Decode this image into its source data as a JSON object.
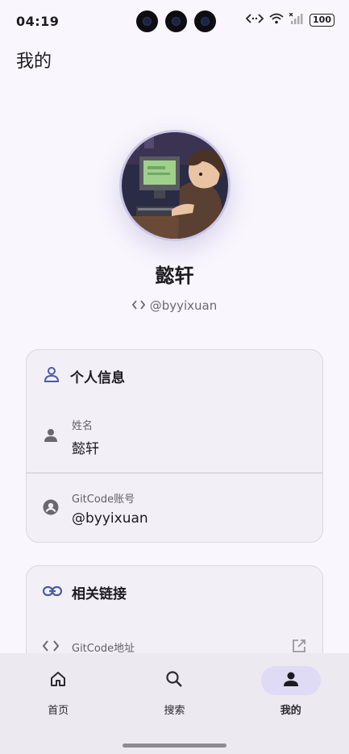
{
  "status_bar": {
    "time": "04:19",
    "battery": "100"
  },
  "page": {
    "title": "我的"
  },
  "profile": {
    "name": "懿轩",
    "handle": "@byyixuan"
  },
  "personal_info": {
    "title": "个人信息",
    "rows": [
      {
        "label": "姓名",
        "value": "懿轩"
      },
      {
        "label": "GitCode账号",
        "value": "@byyixuan"
      }
    ]
  },
  "links": {
    "title": "相关链接",
    "rows": [
      {
        "label": "GitCode地址"
      }
    ]
  },
  "bottom_nav": {
    "items": [
      {
        "label": "首页",
        "icon": "home-icon"
      },
      {
        "label": "搜索",
        "icon": "search-icon"
      },
      {
        "label": "我的",
        "icon": "person-icon",
        "active": true
      }
    ]
  },
  "colors": {
    "background": "#f9f6fd",
    "card": "#f2eff6",
    "accent": "#4a5ba8",
    "active_pill": "#dfdbf5"
  }
}
